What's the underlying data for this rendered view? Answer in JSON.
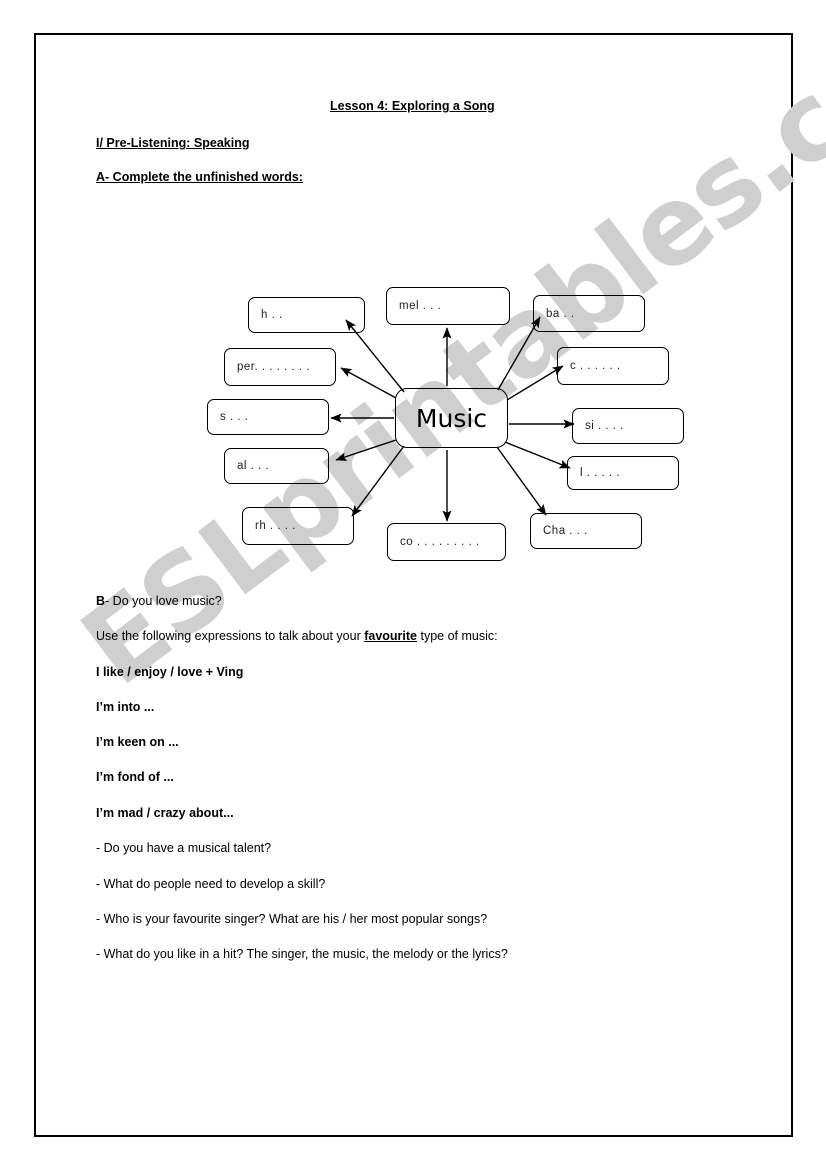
{
  "document": {
    "title": "Lesson 4: Exploring a Song",
    "section_heading": "I/ Pre-Listening: Speaking",
    "task_a_heading": "A- Complete the unfinished words:",
    "watermark": "ESLprintables.com"
  },
  "diagram": {
    "center_label": "Music",
    "nodes": [
      {
        "id": "h",
        "label": "h . ."
      },
      {
        "id": "per",
        "label": "per. . . . . . . ."
      },
      {
        "id": "s",
        "label": "s . . ."
      },
      {
        "id": "al",
        "label": "al . . ."
      },
      {
        "id": "rh",
        "label": "rh . . . ."
      },
      {
        "id": "mel",
        "label": "mel . . ."
      },
      {
        "id": "co",
        "label": "co . . . . . . . . ."
      },
      {
        "id": "ba",
        "label": "ba . ."
      },
      {
        "id": "c",
        "label": "c . . . . . ."
      },
      {
        "id": "si",
        "label": "si . . . ."
      },
      {
        "id": "l",
        "label": "l . . . . ."
      },
      {
        "id": "cha",
        "label": "Cha . . ."
      }
    ]
  },
  "task_b": {
    "prompt_bold": "B",
    "prompt_rest": "- Do you love music?",
    "instruction_before": "Use the following expressions to talk about your ",
    "instruction_emphasis": "favourite",
    "instruction_after": " type of music:",
    "expressions": [
      "I like / enjoy / love + Ving",
      "I’m into ...",
      "I’m keen on ...",
      "I’m fond of ...",
      "I’m mad / crazy about..."
    ],
    "questions": [
      "- Do you have a musical talent?",
      "- What do people need to develop a skill?",
      "- Who is your favourite singer? What are his / her most popular songs?",
      "- What do you like in a hit? The singer, the music, the melody or the lyrics?"
    ]
  },
  "colors": {
    "page_background": "#ffffff",
    "ink": "#000000",
    "watermark": "#cfcfcf"
  }
}
